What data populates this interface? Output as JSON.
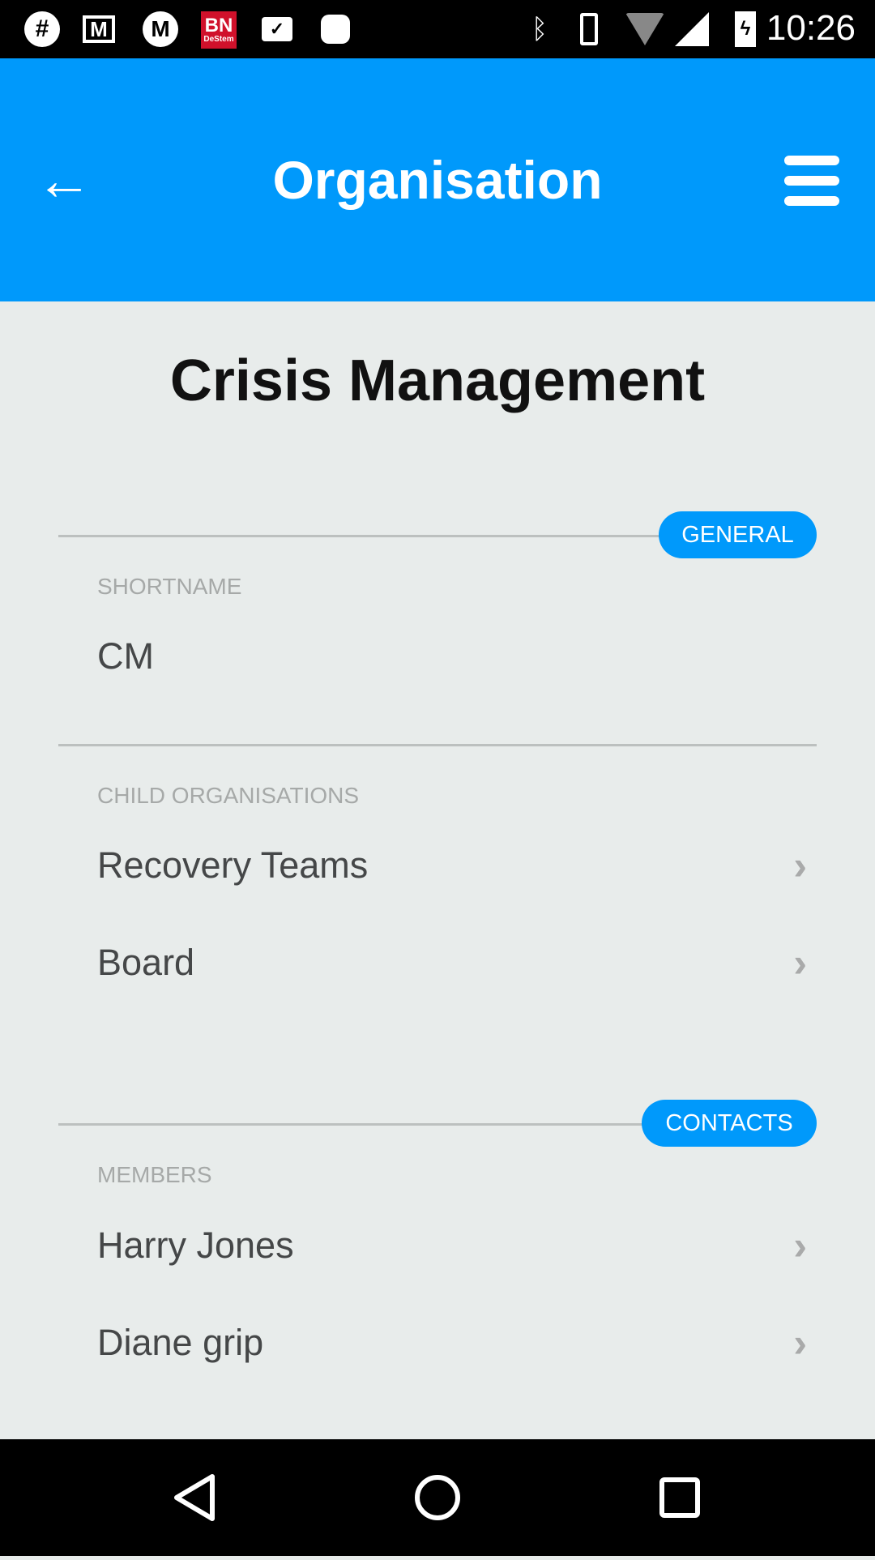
{
  "status_bar": {
    "time": "10:26",
    "left_icons": [
      "slack-icon",
      "gmail-icon",
      "mountain-app-icon",
      "bn-destem-icon",
      "briefcase-check-icon",
      "android-icon"
    ],
    "right_icons": [
      "bluetooth-icon",
      "vibrate-icon",
      "wifi-icon",
      "signal-icon",
      "battery-charging-icon"
    ],
    "bn_text": "BN",
    "bn_sub": "DeStem"
  },
  "app_bar": {
    "title": "Organisation",
    "color": "#0099fb"
  },
  "page": {
    "title": "Crisis Management",
    "general": {
      "badge": "GENERAL",
      "shortname_label": "SHORTNAME",
      "shortname_value": "CM",
      "child_label": "CHILD ORGANISATIONS",
      "children": [
        {
          "name": "Recovery Teams"
        },
        {
          "name": "Board"
        }
      ]
    },
    "contacts": {
      "badge": "CONTACTS",
      "members_label": "MEMBERS",
      "members": [
        {
          "name": "Harry Jones"
        },
        {
          "name": "Diane grip"
        }
      ]
    }
  },
  "nav_bar": {
    "icons": [
      "back-triangle-icon",
      "home-circle-icon",
      "recents-square-icon"
    ]
  }
}
